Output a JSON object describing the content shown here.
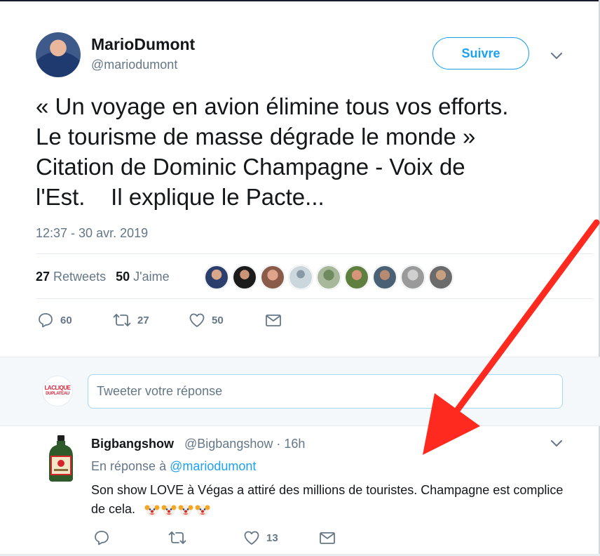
{
  "tweet": {
    "display_name": "MarioDumont",
    "handle": "@mariodumont",
    "follow_label": "Suivre",
    "text": "« Un voyage en avion élimine tous vos efforts.\nLe tourisme de masse dégrade le monde »\nCitation de Dominic Champagne - Voix de\nl'Est.    Il explique le Pacte...",
    "timestamp": "12:37 - 30 avr. 2019",
    "stats": {
      "retweets_count": "27",
      "retweets_label": "Retweets",
      "likes_count": "50",
      "likes_label": "J'aime"
    },
    "actions": {
      "reply_count": "60",
      "retweet_count": "27",
      "like_count": "50"
    }
  },
  "reply_box": {
    "placeholder": "Tweeter votre réponse",
    "avatar_line1": "LACLIQUE",
    "avatar_line2": "DUPLATEAU"
  },
  "reply_tweet": {
    "display_name": "Bigbangshow",
    "handle_time": "@Bigbangshow · 16h",
    "in_reply_prefix": "En réponse à",
    "in_reply_mention": "@mariodumont",
    "text": "Son show LOVE à Végas a attiré des millions de touristes. Champagne est complice de cela.",
    "actions": {
      "like_count": "13"
    }
  },
  "colors": {
    "accent": "#1da1f2",
    "secondary_text": "#657786",
    "annotation_arrow": "#ff2a1f"
  }
}
